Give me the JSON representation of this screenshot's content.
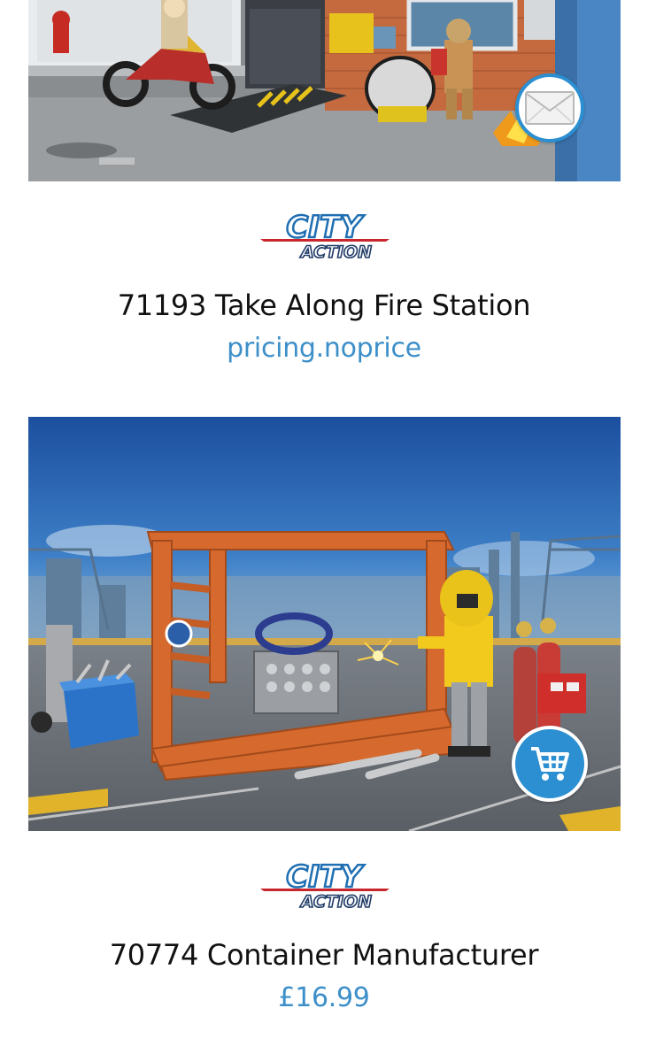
{
  "products": [
    {
      "id_label": "71193 Take Along Fire Station",
      "price": "pricing.noprice",
      "brand_line1": "CITY",
      "brand_line2": "ACTION",
      "action_icon": "envelope-icon"
    },
    {
      "id_label": "70774 Container Manufacturer",
      "price": "£16.99",
      "brand_line1": "CITY",
      "brand_line2": "ACTION",
      "action_icon": "cart-icon"
    }
  ],
  "colors": {
    "accent": "#2b8fd1",
    "price_text": "#3d8fc9",
    "title_text": "#111111",
    "logo_red": "#c8262c",
    "logo_blue": "#1f6fb2"
  }
}
